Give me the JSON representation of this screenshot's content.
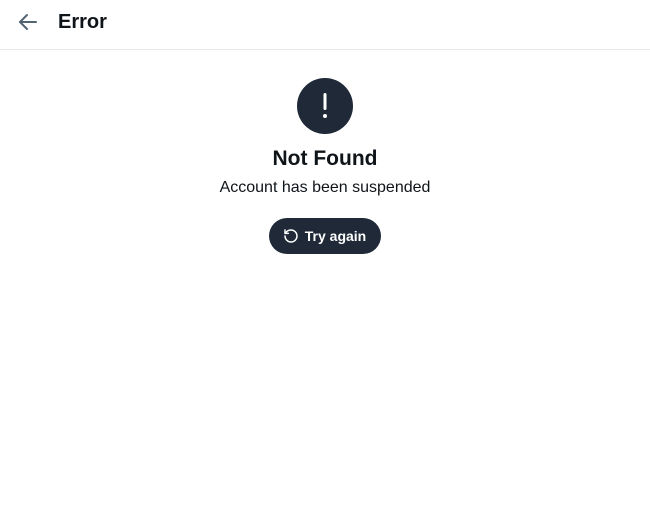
{
  "header": {
    "back_icon": "arrow-left-icon",
    "title": "Error"
  },
  "error": {
    "icon": "exclamation-icon",
    "title": "Not Found",
    "message": "Account has been suspended"
  },
  "retry_button": {
    "icon": "rotate-ccw-icon",
    "label": "Try again"
  },
  "colors": {
    "dark": "#1f2937",
    "text": "#0f1419",
    "divider": "#e6e8eb",
    "back_arrow": "#536471"
  }
}
